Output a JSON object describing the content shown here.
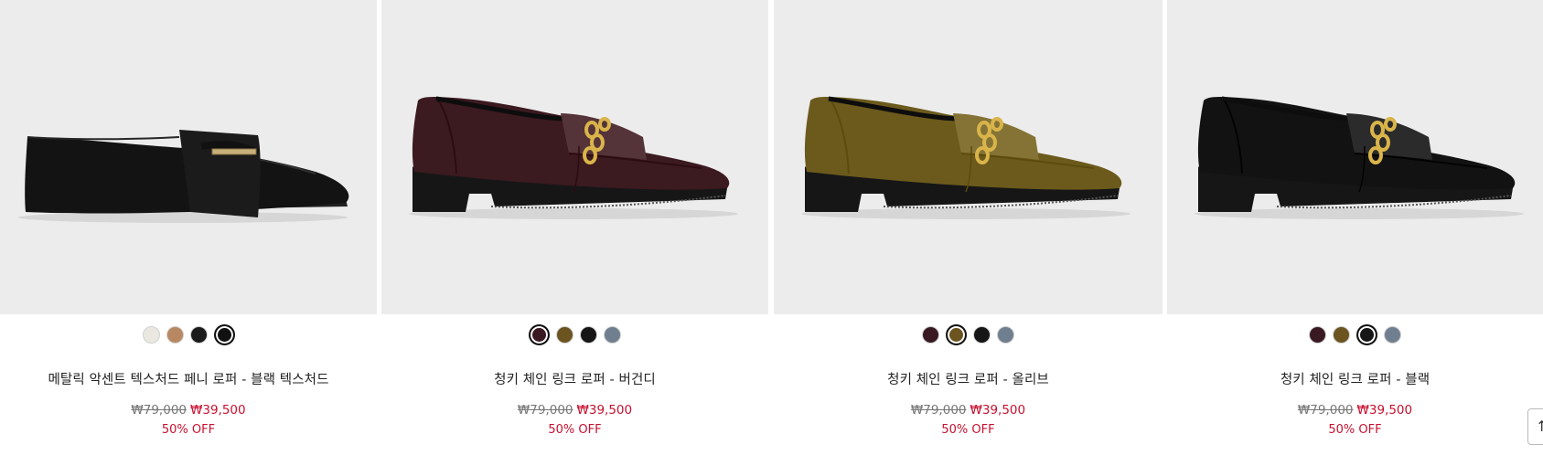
{
  "products": [
    {
      "name": "메탈릭 악센트 텍스처드 페니 로퍼 - 블랙 텍스처드",
      "original_price": "₩79,000",
      "sale_price": "₩39,500",
      "discount": "50% OFF",
      "shoe": "penny",
      "shoe_color": "#131313",
      "swatches": [
        {
          "color": "#ebe8e1",
          "selected": false
        },
        {
          "color": "#b88863",
          "selected": false
        },
        {
          "color": "#1b1b1b",
          "selected": false
        },
        {
          "color": "#111111",
          "selected": true
        }
      ]
    },
    {
      "name": "청키 체인 링크 로퍼 - 버건디",
      "original_price": "₩79,000",
      "sale_price": "₩39,500",
      "discount": "50% OFF",
      "shoe": "chain",
      "shoe_color": "#3b1a20",
      "swatches": [
        {
          "color": "#3a1a22",
          "selected": true
        },
        {
          "color": "#6b5420",
          "selected": false
        },
        {
          "color": "#161616",
          "selected": false
        },
        {
          "color": "#6f7f90",
          "selected": false
        }
      ]
    },
    {
      "name": "청키 체인 링크 로퍼 - 올리브",
      "original_price": "₩79,000",
      "sale_price": "₩39,500",
      "discount": "50% OFF",
      "shoe": "chain",
      "shoe_color": "#6b5a1c",
      "swatches": [
        {
          "color": "#3a1a22",
          "selected": false
        },
        {
          "color": "#6b5420",
          "selected": true
        },
        {
          "color": "#161616",
          "selected": false
        },
        {
          "color": "#6f7f90",
          "selected": false
        }
      ]
    },
    {
      "name": "청키 체인 링크 로퍼 - 블랙",
      "original_price": "₩79,000",
      "sale_price": "₩39,500",
      "discount": "50% OFF",
      "shoe": "chain",
      "shoe_color": "#121212",
      "swatches": [
        {
          "color": "#3a1a22",
          "selected": false
        },
        {
          "color": "#6b5420",
          "selected": false
        },
        {
          "color": "#161616",
          "selected": true
        },
        {
          "color": "#6f7f90",
          "selected": false
        }
      ]
    }
  ],
  "scroll_top_icon": "arrow-up-icon",
  "scroll_top_glyph": "↑"
}
